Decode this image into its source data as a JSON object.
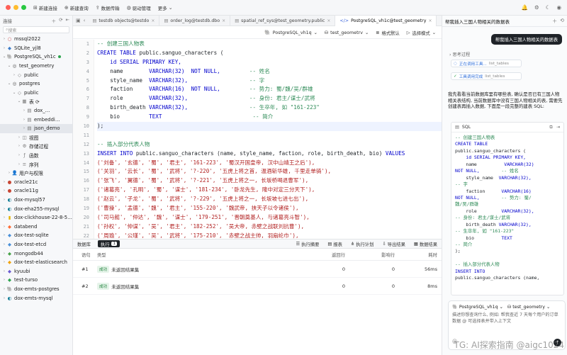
{
  "colors": {
    "accent": "#3b63d9",
    "keyword": "#0000cc",
    "comment": "#2e8b57",
    "string": "#b22222",
    "identifier": "#1f2328",
    "dark": "#1f2328",
    "success": "#2da44e"
  },
  "topbar": {
    "items": [
      {
        "icon": "grid-icon",
        "label": "新建连接"
      },
      {
        "icon": "file-plus-icon",
        "label": "新建查询"
      },
      {
        "icon": "upload-icon",
        "label": "数据传输"
      },
      {
        "icon": "dashboard-icon",
        "label": "驱动管理"
      },
      {
        "icon": "more-icon",
        "label": "更多"
      }
    ]
  },
  "sidebar": {
    "title": "连接",
    "search_placeholder": "搜索",
    "tree": [
      {
        "level": 0,
        "chev": "›",
        "icon": "○",
        "icon_color": "#c94c4c",
        "label": "mssql2022"
      },
      {
        "level": 0,
        "chev": "›",
        "icon": "◆",
        "icon_color": "#3d7cc9",
        "label": "SQLite_yjl8"
      },
      {
        "level": 0,
        "chev": "⌄",
        "icon": "🐘",
        "icon_color": "#336791",
        "label": "PostgreSQL_vh1c",
        "connected": true
      },
      {
        "level": 1,
        "chev": "⌄",
        "icon": "◎",
        "icon_color": "#555",
        "label": "test_geometry"
      },
      {
        "level": 2,
        "chev": "›",
        "icon": "◇",
        "icon_color": "#777",
        "label": "public"
      },
      {
        "level": 1,
        "chev": "⌄",
        "icon": "◎",
        "icon_color": "#555",
        "label": "postgres"
      },
      {
        "level": 2,
        "chev": "⌄",
        "icon": "◇",
        "icon_color": "#777",
        "label": "public"
      },
      {
        "level": 3,
        "chev": "⌄",
        "icon": "▦",
        "icon_color": "#777",
        "label": "表 ⟳"
      },
      {
        "level": 4,
        "chev": "›",
        "icon": "▤",
        "icon_color": "#777",
        "label": "dox_…"
      },
      {
        "level": 4,
        "chev": "›",
        "icon": "▤",
        "icon_color": "#777",
        "label": "embeddi…"
      },
      {
        "level": 4,
        "chev": "›",
        "icon": "▤",
        "icon_color": "#777",
        "label": "json_demo",
        "selected": true
      },
      {
        "level": 3,
        "chev": "›",
        "icon": "◫",
        "icon_color": "#777",
        "label": "视图"
      },
      {
        "level": 3,
        "chev": "›",
        "icon": "⚙",
        "icon_color": "#777",
        "label": "存储过程"
      },
      {
        "level": 3,
        "chev": "›",
        "icon": "ƒ",
        "icon_color": "#777",
        "label": "函数"
      },
      {
        "level": 3,
        "chev": "›",
        "icon": "≡",
        "icon_color": "#777",
        "label": "序列"
      },
      {
        "level": 1,
        "chev": "›",
        "icon": "👤",
        "icon_color": "#777",
        "label": "用户与权限"
      },
      {
        "level": 0,
        "chev": "›",
        "icon": "●",
        "icon_color": "#c74634",
        "label": "oracle21c"
      },
      {
        "level": 0,
        "chev": "›",
        "icon": "●",
        "icon_color": "#c74634",
        "label": "oracle11g"
      },
      {
        "level": 0,
        "chev": "›",
        "icon": "◐",
        "icon_color": "#00758f",
        "label": "dox-mysql57"
      },
      {
        "level": 0,
        "chev": "›",
        "icon": "◐",
        "icon_color": "#00758f",
        "label": "dox-eha255-mysql"
      },
      {
        "level": 0,
        "chev": "›",
        "icon": "▮",
        "icon_color": "#e5b400",
        "label": "dox-clickhouse-22-8-5…"
      },
      {
        "level": 0,
        "chev": "›",
        "icon": "◆",
        "icon_color": "#ff6b35",
        "label": "databend"
      },
      {
        "level": 0,
        "chev": "›",
        "icon": "◆",
        "icon_color": "#4a90d9",
        "label": "dox-test-sqlite"
      },
      {
        "level": 0,
        "chev": "›",
        "icon": "◆",
        "icon_color": "#4a90d9",
        "label": "dox-test-etcd"
      },
      {
        "level": 0,
        "chev": "›",
        "icon": "◆",
        "icon_color": "#47a248",
        "label": "mongodb44"
      },
      {
        "level": 0,
        "chev": "›",
        "icon": "◆",
        "icon_color": "#f0a30a",
        "label": "dox-test-elasticsearch"
      },
      {
        "level": 0,
        "chev": "›",
        "icon": "◆",
        "icon_color": "#6b5bd2",
        "label": "kyuubi"
      },
      {
        "level": 0,
        "chev": "›",
        "icon": "◆",
        "icon_color": "#2da44e",
        "label": "test-turso"
      },
      {
        "level": 0,
        "chev": "›",
        "icon": "🐘",
        "icon_color": "#336791",
        "label": "dox-emts-postgres"
      },
      {
        "level": 0,
        "chev": "›",
        "icon": "◐",
        "icon_color": "#00758f",
        "label": "dox-emts-mysql"
      }
    ]
  },
  "tabs": [
    {
      "icon": "▤",
      "label": "testdb objects@testdo",
      "active": false
    },
    {
      "icon": "▤",
      "label": "order_log@testdb.dbo",
      "active": false
    },
    {
      "icon": "▤",
      "label": "spatial_ref_sys@test_geometry.public",
      "active": false
    },
    {
      "icon": "</>",
      "label": "PostgreSQL_vh1c@test_geometry",
      "active": true
    }
  ],
  "editor_toolbar": {
    "connection": "PostgreSQL_vh1q",
    "database": "test_geometrv",
    "format": "格式默认",
    "execute": "选择模式"
  },
  "code_lines": [
    [
      [
        "-- 创建三国人物表",
        "comment"
      ]
    ],
    [
      [
        "CREATE TABLE ",
        "keyword"
      ],
      [
        "public.sanguo_characters (",
        "identifier"
      ]
    ],
    [
      [
        "    id SERIAL PRIMARY KEY,",
        "keyword"
      ]
    ],
    [
      [
        "    name        ",
        "identifier"
      ],
      [
        "VARCHAR(32)  NOT NULL,         ",
        "keyword"
      ],
      [
        "-- 姓名",
        "comment"
      ]
    ],
    [
      [
        "    style_name  ",
        "identifier"
      ],
      [
        "VARCHAR(32),                   ",
        "keyword"
      ],
      [
        "-- 字",
        "comment"
      ]
    ],
    [
      [
        "    faction     ",
        "identifier"
      ],
      [
        "VARCHAR(16)  NOT NULL,         ",
        "keyword"
      ],
      [
        "-- 势力: 蜀/魏/吴/群雄",
        "comment"
      ]
    ],
    [
      [
        "    role        ",
        "identifier"
      ],
      [
        "VARCHAR(32),                   ",
        "keyword"
      ],
      [
        "-- 身份: 君主/谋士/武将",
        "comment"
      ]
    ],
    [
      [
        "    birth_death ",
        "identifier"
      ],
      [
        "VARCHAR(32),                   ",
        "keyword"
      ],
      [
        "-- 生卒年, 如 \"161-223\"",
        "comment"
      ]
    ],
    [
      [
        "    bio         ",
        "identifier"
      ],
      [
        "TEXT                            ",
        "keyword"
      ],
      [
        "-- 简介",
        "comment"
      ]
    ],
    [
      [
        ");",
        "identifier"
      ]
    ],
    [
      [
        "",
        "identifier"
      ]
    ],
    [
      [
        "-- 插入部分代表人物",
        "comment"
      ]
    ],
    [
      [
        "INSERT INTO ",
        "keyword"
      ],
      [
        "public.sanguo_characters (name, style_name, faction, role, birth_death, bio) ",
        "identifier"
      ],
      [
        "VALUES",
        "keyword"
      ]
    ],
    [
      [
        "('刘备', '玄德', '蜀', '君主', '161-223', '蜀汉开国皇帝, 汉中山靖王之后'),",
        "string"
      ]
    ],
    [
      [
        "('关羽', '云长', '蜀', '武将', '?-220', '五虎上将之首, 温酒斩华雄, 千里走单骑'),",
        "string"
      ]
    ],
    [
      [
        "('张飞', '翼德', '蜀', '武将', '?-221', '五虎上将之一, 长坂桥喝退曹军'),",
        "string"
      ]
    ],
    [
      [
        "('诸葛亮', '孔明', '蜀', '谋士', '181-234', '卧龙先生, 隆中对定三分天下'),",
        "string"
      ]
    ],
    [
      [
        "('赵云', '子龙', '蜀', '武将', '?-229', '五虎上将之一, 长坂坡七进七出'),",
        "string"
      ]
    ],
    [
      [
        "('曹操', '孟德', '魏', '君主', '155-220', '魏武帝, 挟天子以令诸侯'),",
        "string"
      ]
    ],
    [
      [
        "('司马懿', '仲达', '魏', '谋士', '179-251', '晋朝奠基人, 与诸葛亮斗智'),",
        "string"
      ]
    ],
    [
      [
        "('孙权', '仲谋', '吴', '君主', '182-252', '吴大帝, 赤壁之战联刘抗曹'),",
        "string"
      ]
    ],
    [
      [
        "('周瑜', '公瑾', '吴', '武将', '175-210', '赤壁之战主帅, 羽扇纶巾'),",
        "string"
      ]
    ]
  ],
  "results": {
    "tab_data": "数据库",
    "tab_exec": "执行",
    "tab_exec_count": "1",
    "actions": [
      "执行摘要",
      "报表",
      "执行计划",
      "导出结果",
      "数据结果"
    ],
    "headers": {
      "seq": "语句",
      "type": "类型",
      "returned": "返回行",
      "affected": "影响行",
      "time": "耗时"
    },
    "rows": [
      {
        "seq": "#1",
        "tag": "成功",
        "type": "未返回结果集",
        "returned": "0",
        "affected": "0",
        "time": "56ms"
      },
      {
        "seq": "#2",
        "tag": "成功",
        "type": "未返回结果集",
        "returned": "0",
        "affected": "0",
        "time": "8ms"
      }
    ]
  },
  "panel": {
    "title": "帮我插入三国人物相关的数据表",
    "user_message": "帮我插入三国人物相关的数据表",
    "thinking": "思考过程",
    "tool1_label": "正在调用工具...",
    "tool1_detail": "list_tables",
    "tool2_label": "工具调用完成",
    "tool2_detail": "list_tables",
    "answer": "我先看看当前数据库里有哪些表, 确认是否已有三国人物相关表结构, 当前数据库中没有三国人物相关的表, 需要先创建表再插入数据, 下面是一段完整的建表 SQL:",
    "sql_card_title": "SQL",
    "sql_lines": [
      [
        [
          "-- 创建三国人物表",
          "comment"
        ]
      ],
      [
        [
          "CREATE TABLE",
          "keyword"
        ]
      ],
      [
        [
          "public.sanguo_characters (",
          "identifier"
        ]
      ],
      [
        [
          "    id SERIAL PRIMARY KEY,",
          "keyword"
        ]
      ],
      [
        [
          "    name          ",
          "identifier"
        ],
        [
          "VARCHAR(32)",
          "keyword"
        ]
      ],
      [
        [
          "NOT NULL,",
          "keyword"
        ],
        [
          "        -- 姓名",
          "comment"
        ]
      ],
      [
        [
          "    style_name  ",
          "identifier"
        ],
        [
          "VARCHAR(32),",
          "keyword"
        ]
      ],
      [
        [
          "-- 字",
          "comment"
        ]
      ],
      [
        [
          "    faction      ",
          "identifier"
        ],
        [
          "VARCHAR(16)",
          "keyword"
        ]
      ],
      [
        [
          "NOT NULL,",
          "keyword"
        ],
        [
          "        -- 势力: 蜀/",
          "comment"
        ]
      ],
      [
        [
          "魏/吴/群雄",
          "comment"
        ]
      ],
      [
        [
          "    role         ",
          "identifier"
        ],
        [
          "VARCHAR(32),",
          "keyword"
        ]
      ],
      [
        [
          "-- 身份: 君主/谋士/武将",
          "comment"
        ]
      ],
      [
        [
          "    birth_death ",
          "identifier"
        ],
        [
          "VARCHAR(32),",
          "keyword"
        ]
      ],
      [
        [
          "-- 生卒年, 如 \"161-223\"",
          "comment"
        ]
      ],
      [
        [
          "    bio          ",
          "identifier"
        ],
        [
          "TEXT",
          "keyword"
        ]
      ],
      [
        [
          "-- 简介",
          "comment"
        ]
      ],
      [
        [
          ");",
          "identifier"
        ]
      ],
      [
        [
          "",
          "identifier"
        ]
      ],
      [
        [
          "-- 插入部分代表人物",
          "comment"
        ]
      ],
      [
        [
          "INSERT INTO",
          "keyword"
        ]
      ],
      [
        [
          "public.sanguo_characters (name,",
          "identifier"
        ]
      ]
    ],
    "input_connection": "PostgreSQL_vh1q",
    "input_database": "test_geometry",
    "input_placeholder": "描述你想查询什么, 例如: 帮我查近 7 天每个用户的订单数据 @ 可选择表并带入上下文"
  },
  "watermark": "TG: AI探索指南 @aigc1024"
}
